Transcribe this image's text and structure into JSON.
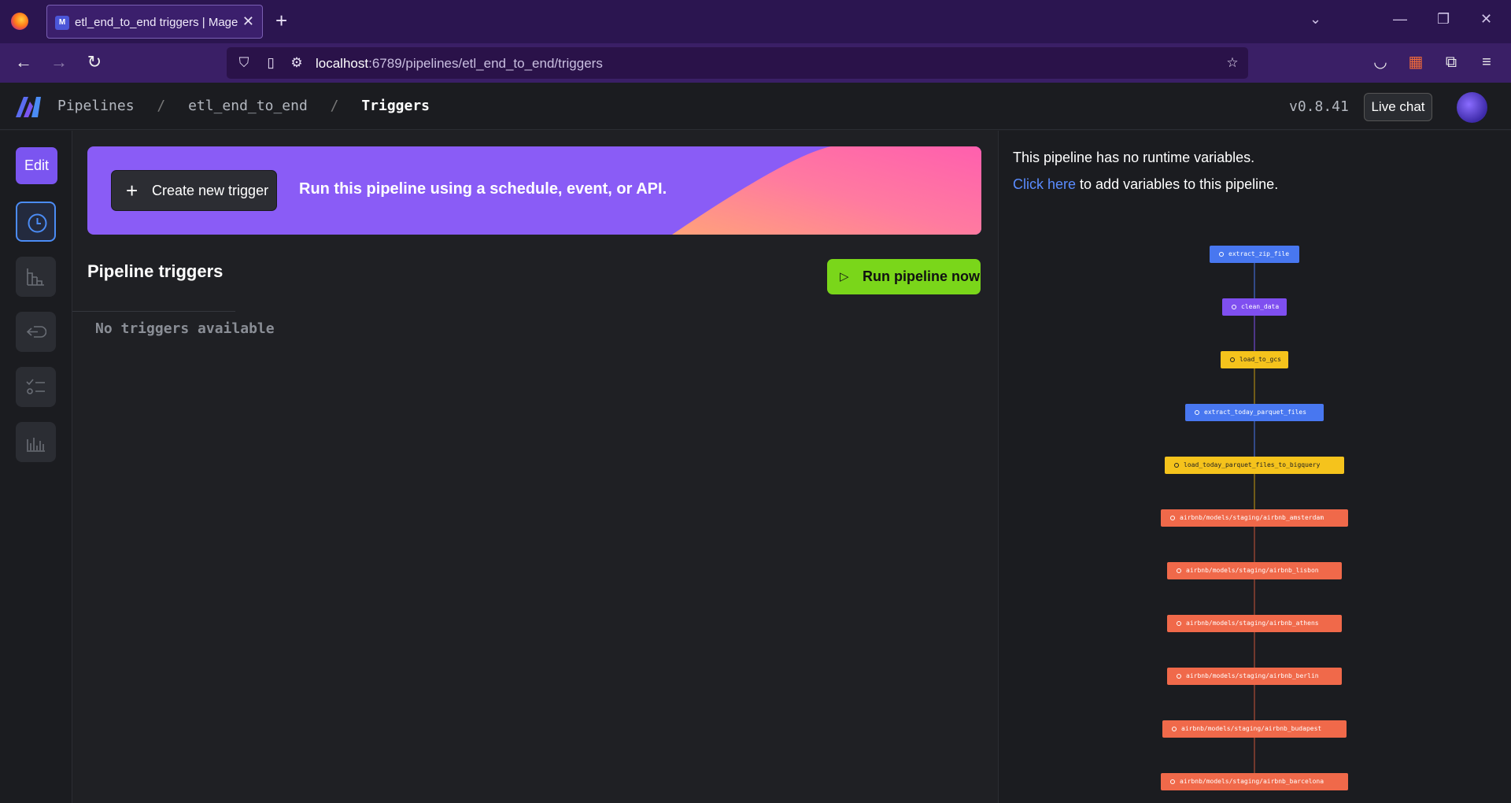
{
  "browser": {
    "tab_title": "etl_end_to_end triggers | Mage",
    "tab_favicon": "M",
    "url_host": "localhost",
    "url_path": ":6789/pipelines/etl_end_to_end/triggers"
  },
  "header": {
    "breadcrumbs": [
      "Pipelines",
      "etl_end_to_end",
      "Triggers"
    ],
    "separator": "/",
    "version": "v0.8.41",
    "live_chat": "Live chat"
  },
  "rail": {
    "edit_label": "Edit",
    "icons": [
      "clock-icon",
      "blocks-icon",
      "logs-icon",
      "checklist-icon",
      "monitor-icon"
    ]
  },
  "banner": {
    "create_label": "Create new trigger",
    "text": "Run this pipeline using a schedule, event, or API."
  },
  "triggers": {
    "title": "Pipeline triggers",
    "run_label": "Run pipeline now",
    "empty_text": "No triggers available"
  },
  "variables": {
    "line1": "This pipeline has no runtime variables.",
    "link": "Click here",
    "line2_rest": " to add variables to this pipeline."
  },
  "colors": {
    "accent": "#7b55f0",
    "run_green": "#7ad61a",
    "block_data_loader": "#4877f0",
    "block_transformer": "#7f4ff0",
    "block_exporter": "#f5c31c",
    "block_dbt": "#f0694a"
  },
  "dag_nodes": [
    {
      "label": "extract_zip_file",
      "kind": "blue"
    },
    {
      "label": "clean_data",
      "kind": "purple"
    },
    {
      "label": "load_to_gcs",
      "kind": "yellow"
    },
    {
      "label": "extract_today_parquet_files",
      "kind": "blue"
    },
    {
      "label": "load_today_parquet_files_to_bigquery",
      "kind": "yellow"
    },
    {
      "label": "airbnb/models/staging/airbnb_amsterdam",
      "kind": "orange"
    },
    {
      "label": "airbnb/models/staging/airbnb_lisbon",
      "kind": "orange"
    },
    {
      "label": "airbnb/models/staging/airbnb_athens",
      "kind": "orange"
    },
    {
      "label": "airbnb/models/staging/airbnb_berlin",
      "kind": "orange"
    },
    {
      "label": "airbnb/models/staging/airbnb_budapest",
      "kind": "orange"
    },
    {
      "label": "airbnb/models/staging/airbnb_barcelona",
      "kind": "orange"
    }
  ]
}
